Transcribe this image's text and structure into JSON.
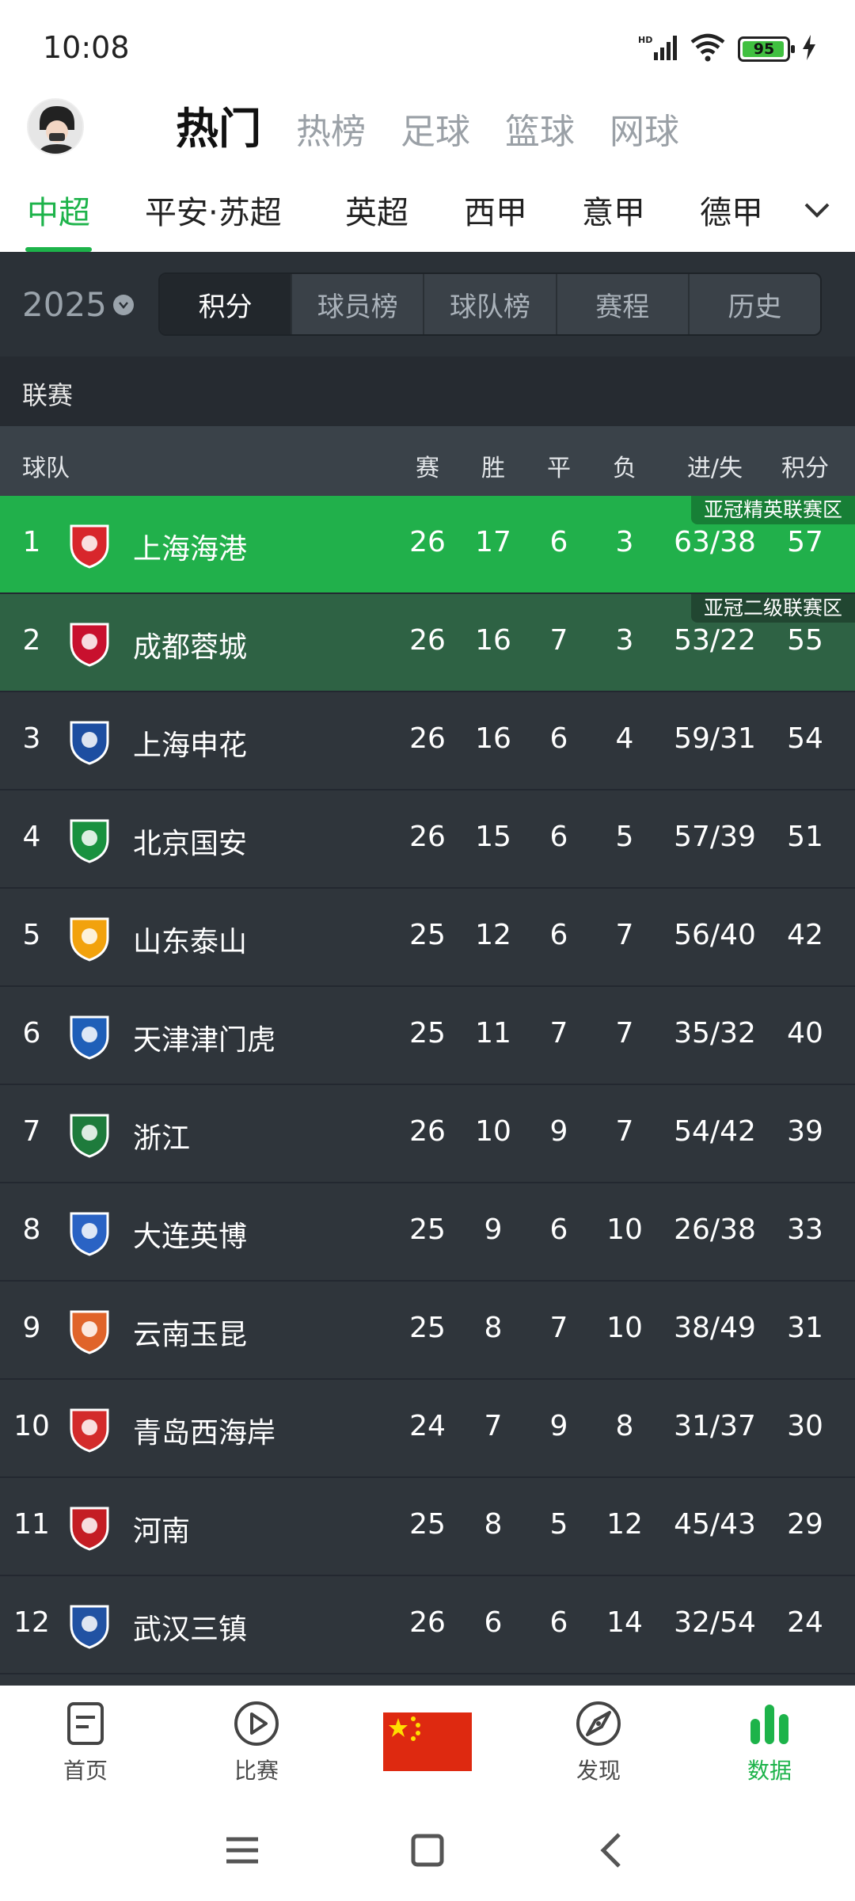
{
  "status": {
    "time": "10:08",
    "network": "HD",
    "battery": "95"
  },
  "main_nav": {
    "items": [
      "热门",
      "热榜",
      "足球",
      "篮球",
      "网球"
    ],
    "active_index": 0
  },
  "league_tabs": {
    "items": [
      "中超",
      "平安·苏超",
      "英超",
      "西甲",
      "意甲",
      "德甲"
    ],
    "active_index": 0
  },
  "season": {
    "year": "2025"
  },
  "segments": {
    "items": [
      "积分",
      "球员榜",
      "球队榜",
      "赛程",
      "历史"
    ],
    "active_index": 0
  },
  "league_section_label": "联赛",
  "table": {
    "headers": {
      "team": "球队",
      "played": "赛",
      "win": "胜",
      "draw": "平",
      "loss": "负",
      "goals": "进/失",
      "points": "积分"
    },
    "rows": [
      {
        "rank": "1",
        "team": "上海海港",
        "played": "26",
        "win": "17",
        "draw": "6",
        "loss": "3",
        "goals": "63/38",
        "points": "57",
        "zone": "亚冠精英联赛区",
        "logo_color": "#d8262c"
      },
      {
        "rank": "2",
        "team": "成都蓉城",
        "played": "26",
        "win": "16",
        "draw": "7",
        "loss": "3",
        "goals": "53/22",
        "points": "55",
        "zone": "亚冠二级联赛区",
        "logo_color": "#c8102e"
      },
      {
        "rank": "3",
        "team": "上海申花",
        "played": "26",
        "win": "16",
        "draw": "6",
        "loss": "4",
        "goals": "59/31",
        "points": "54",
        "zone": "",
        "logo_color": "#1d4ea1"
      },
      {
        "rank": "4",
        "team": "北京国安",
        "played": "26",
        "win": "15",
        "draw": "6",
        "loss": "5",
        "goals": "57/39",
        "points": "51",
        "zone": "",
        "logo_color": "#19913f"
      },
      {
        "rank": "5",
        "team": "山东泰山",
        "played": "25",
        "win": "12",
        "draw": "6",
        "loss": "7",
        "goals": "56/40",
        "points": "42",
        "zone": "",
        "logo_color": "#f2a20d"
      },
      {
        "rank": "6",
        "team": "天津津门虎",
        "played": "25",
        "win": "11",
        "draw": "7",
        "loss": "7",
        "goals": "35/32",
        "points": "40",
        "zone": "",
        "logo_color": "#1f5fb8"
      },
      {
        "rank": "7",
        "team": "浙江",
        "played": "26",
        "win": "10",
        "draw": "9",
        "loss": "7",
        "goals": "54/42",
        "points": "39",
        "zone": "",
        "logo_color": "#1e7b3c"
      },
      {
        "rank": "8",
        "team": "大连英博",
        "played": "25",
        "win": "9",
        "draw": "6",
        "loss": "10",
        "goals": "26/38",
        "points": "33",
        "zone": "",
        "logo_color": "#2a63c4"
      },
      {
        "rank": "9",
        "team": "云南玉昆",
        "played": "25",
        "win": "8",
        "draw": "7",
        "loss": "10",
        "goals": "38/49",
        "points": "31",
        "zone": "",
        "logo_color": "#e0642a"
      },
      {
        "rank": "10",
        "team": "青岛西海岸",
        "played": "24",
        "win": "7",
        "draw": "9",
        "loss": "8",
        "goals": "31/37",
        "points": "30",
        "zone": "",
        "logo_color": "#d32b2b"
      },
      {
        "rank": "11",
        "team": "河南",
        "played": "25",
        "win": "8",
        "draw": "5",
        "loss": "12",
        "goals": "45/43",
        "points": "29",
        "zone": "",
        "logo_color": "#c41d24"
      },
      {
        "rank": "12",
        "team": "武汉三镇",
        "played": "26",
        "win": "6",
        "draw": "6",
        "loss": "14",
        "goals": "32/54",
        "points": "24",
        "zone": "",
        "logo_color": "#2152a3"
      }
    ]
  },
  "bottom_nav": {
    "items": [
      {
        "label": "首页",
        "icon": "document-icon"
      },
      {
        "label": "比赛",
        "icon": "play-icon"
      },
      {
        "label": "",
        "icon": "china-flag-icon"
      },
      {
        "label": "发现",
        "icon": "compass-icon"
      },
      {
        "label": "数据",
        "icon": "bar-chart-icon"
      }
    ],
    "active_index": 4
  },
  "colors": {
    "accent": "#1db34a",
    "zone1": "#21b04b",
    "zone2": "#2e6244",
    "dark_bg": "#2f353b"
  }
}
